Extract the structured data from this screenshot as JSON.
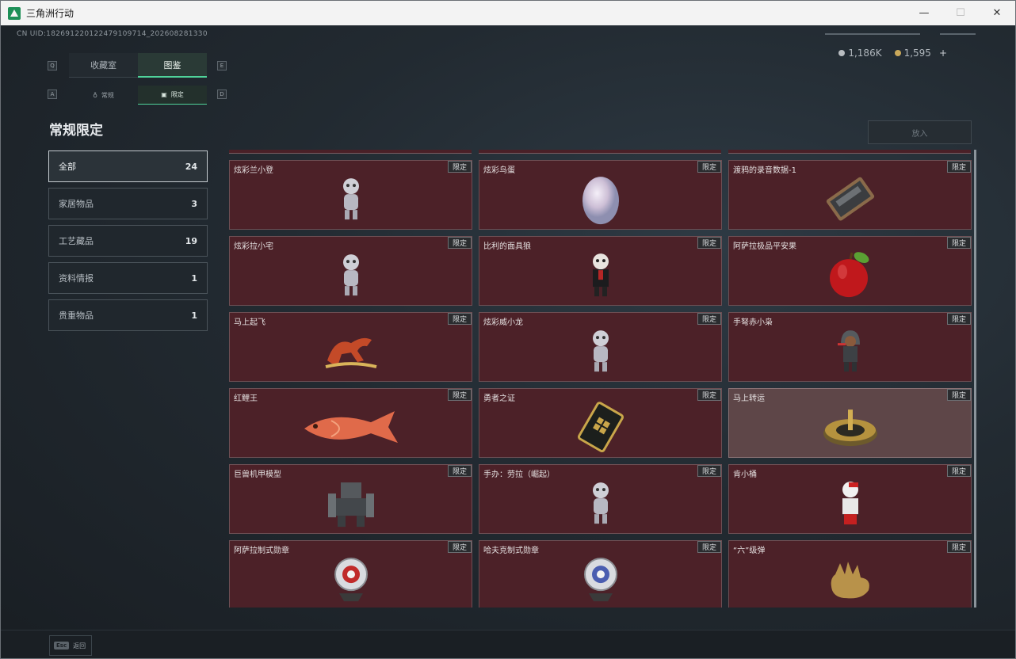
{
  "window": {
    "title": "三角洲行动",
    "minimize": "—",
    "maximize": "☐",
    "close": "✕"
  },
  "uid": "CN UID:182691220122479109714_202608281330",
  "currency": {
    "silver": "1,186K",
    "gold": "1,595",
    "plus": "+"
  },
  "key_hints": {
    "tab_left": "Q",
    "tab_right": "E",
    "sub_left": "A",
    "sub_right": "D"
  },
  "tabs": [
    {
      "label": "收藏室"
    },
    {
      "label": "图鉴"
    }
  ],
  "subtabs": [
    {
      "label": "常规",
      "icon": "flame-icon"
    },
    {
      "label": "限定",
      "icon": "image-icon"
    }
  ],
  "page_title": "常规限定",
  "put_button": "放入",
  "categories": [
    {
      "label": "全部",
      "count": "24"
    },
    {
      "label": "家居物品",
      "count": "3"
    },
    {
      "label": "工艺藏品",
      "count": "19"
    },
    {
      "label": "资料情报",
      "count": "1"
    },
    {
      "label": "贵重物品",
      "count": "1"
    }
  ],
  "items": [
    {
      "name": "炫彩兰小登",
      "tag": "限定",
      "icon": "figurine-icon"
    },
    {
      "name": "炫彩鸟蛋",
      "tag": "限定",
      "icon": "egg-icon"
    },
    {
      "name": "渡鸦的录音数据-1",
      "tag": "限定",
      "icon": "cassette-icon"
    },
    {
      "name": "炫彩拉小宅",
      "tag": "限定",
      "icon": "figurine-icon"
    },
    {
      "name": "比利的面具狼",
      "tag": "限定",
      "icon": "puppet-icon"
    },
    {
      "name": "阿萨拉极品平安果",
      "tag": "限定",
      "icon": "apple-icon"
    },
    {
      "name": "马上起飞",
      "tag": "限定",
      "icon": "horse-icon"
    },
    {
      "name": "炫彩威小龙",
      "tag": "限定",
      "icon": "figurine-icon"
    },
    {
      "name": "手弩赤小枭",
      "tag": "限定",
      "icon": "hooded-figure-icon"
    },
    {
      "name": "红鲤王",
      "tag": "限定",
      "icon": "fish-icon"
    },
    {
      "name": "勇者之证",
      "tag": "限定",
      "icon": "card-icon"
    },
    {
      "name": "马上转运",
      "tag": "限定",
      "icon": "compass-icon"
    },
    {
      "name": "巨兽机甲模型",
      "tag": "限定",
      "icon": "mech-icon"
    },
    {
      "name": "手办：劳拉（崛起）",
      "tag": "限定",
      "icon": "figurine-icon"
    },
    {
      "name": "肯小桶",
      "tag": "限定",
      "icon": "bucket-figure-icon"
    },
    {
      "name": "阿萨拉制式勋章",
      "tag": "限定",
      "icon": "medal-icon"
    },
    {
      "name": "哈夫克制式勋章",
      "tag": "限定",
      "icon": "medal-icon"
    },
    {
      "name": "“六”级弹",
      "tag": "限定",
      "icon": "hand-icon"
    }
  ],
  "bottom": {
    "esc_key": "Esc",
    "esc_label": "返回"
  },
  "colors": {
    "accent": "#4fd39a",
    "card_bg": "#4c2128"
  }
}
